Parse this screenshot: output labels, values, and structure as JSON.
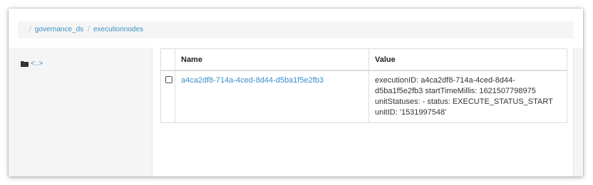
{
  "breadcrumb": {
    "separator": "/",
    "items": [
      "governance_ds",
      "executionnodes"
    ]
  },
  "sidebar": {
    "parent_label": "<..>",
    "parent_icon": "folder-icon"
  },
  "table": {
    "headers": {
      "name": "Name",
      "value": "Value"
    },
    "rows": [
      {
        "name": "a4ca2df8-714a-4ced-8d44-d5ba1f5e2fb3",
        "value": "executionID: a4ca2df8-714a-4ced-8d44-d5ba1f5e2fb3 startTimeMillis: 1621507798975 unitStatuses: - status: EXECUTE_STATUS_START unitID: '1531997548'"
      }
    ]
  },
  "colors": {
    "link": "#3b8ec8",
    "sidebar_bg": "#f5f5f5",
    "breadcrumb_bg": "#f5f5f5"
  }
}
